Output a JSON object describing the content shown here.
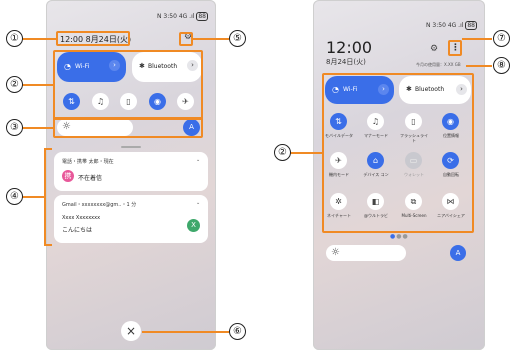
{
  "left": {
    "status": {
      "icons": "N",
      "time": "3:50",
      "signal": "4G .ıl",
      "battery": "88"
    },
    "header": {
      "datetime": "12:00  8月24日(火)"
    },
    "wifi": {
      "label": "Wi-Fi",
      "arrow": "›"
    },
    "bluetooth": {
      "label": "Bluetooth",
      "arrow": "›"
    },
    "notifications": [
      {
        "header": "電話・携帯 太郎・現在",
        "avatar": "携",
        "body": "不在着信"
      },
      {
        "header": "Gmail・xxxxxxxx@gm..・1 分",
        "title": "Xxxx Xxxxxxxx",
        "body": "こんにちは",
        "avatar": "X"
      }
    ],
    "close": "×"
  },
  "right": {
    "status": {
      "icons": "N",
      "time": "3:50",
      "signal": "4G .ıl",
      "battery": "88"
    },
    "clock": "12:00",
    "date": "8月24日(火)",
    "data_usage": "今月の使用量：X.XX GB",
    "wifi": {
      "label": "Wi-Fi",
      "arrow": "›"
    },
    "bluetooth": {
      "label": "Bluetooth",
      "arrow": "›"
    },
    "toggles": [
      {
        "label": "モバイルデータ"
      },
      {
        "label": "マナーモード"
      },
      {
        "label": "フラッシュライト"
      },
      {
        "label": "位置情報"
      },
      {
        "label": "機内モード"
      },
      {
        "label": "デバイス コン"
      },
      {
        "label": "ウォレット"
      },
      {
        "label": "自動回転"
      },
      {
        "label": "ネイチャート"
      },
      {
        "label": "@ウルトラビ"
      },
      {
        "label": "Multi-Screen"
      },
      {
        "label": "ニアバイシェア"
      }
    ]
  },
  "callouts": [
    "①",
    "②",
    "③",
    "④",
    "⑤",
    "⑥",
    "⑦",
    "⑧",
    "②"
  ],
  "colors": {
    "accent": "#3a6ee8",
    "callout_line": "#f08a24"
  }
}
